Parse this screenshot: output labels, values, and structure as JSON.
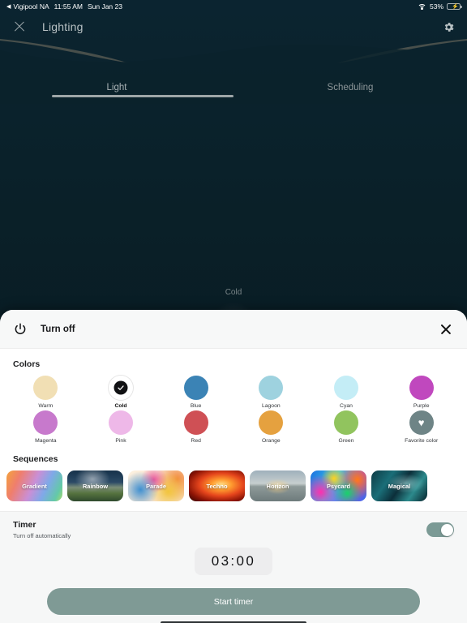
{
  "status_bar": {
    "back_glyph": "◀",
    "carrier": "Vigipool NA",
    "time": "11:55 AM",
    "date": "Sun Jan 23",
    "battery_percent": "53%",
    "wifi_icon": "wifi-icon",
    "battery_icon": "battery-charging-icon"
  },
  "header": {
    "close_icon": "close-icon",
    "title": "Lighting",
    "settings_icon": "gear-icon"
  },
  "tabs": [
    {
      "label": "Light",
      "active": true
    },
    {
      "label": "Scheduling",
      "active": false
    }
  ],
  "dial": {
    "label": "Cold"
  },
  "sheet": {
    "power_icon": "power-icon",
    "title": "Turn off",
    "close_icon": "close-icon"
  },
  "colors": {
    "section_title": "Colors",
    "items": [
      {
        "label": "Warm",
        "hex": "#F1DFB4",
        "selected": false,
        "icon": ""
      },
      {
        "label": "Cold",
        "hex": "#FFFFFF",
        "selected": true,
        "icon": "check-icon"
      },
      {
        "label": "Blue",
        "hex": "#3B83B5",
        "selected": false,
        "icon": ""
      },
      {
        "label": "Lagoon",
        "hex": "#9ED2DF",
        "selected": false,
        "icon": ""
      },
      {
        "label": "Cyan",
        "hex": "#C4EDF6",
        "selected": false,
        "icon": ""
      },
      {
        "label": "Purple",
        "hex": "#C048BE",
        "selected": false,
        "icon": ""
      },
      {
        "label": "Magenta",
        "hex": "#C779CC",
        "selected": false,
        "icon": ""
      },
      {
        "label": "Pink",
        "hex": "#EEB8E8",
        "selected": false,
        "icon": ""
      },
      {
        "label": "Red",
        "hex": "#CF5055",
        "selected": false,
        "icon": ""
      },
      {
        "label": "Orange",
        "hex": "#E5A13F",
        "selected": false,
        "icon": ""
      },
      {
        "label": "Green",
        "hex": "#91C45E",
        "selected": false,
        "icon": ""
      },
      {
        "label": "Favorite color",
        "hex": "#6E8486",
        "selected": false,
        "icon": "heart-icon"
      }
    ]
  },
  "sequences": {
    "section_title": "Sequences",
    "items": [
      {
        "label": "Gradient"
      },
      {
        "label": "Rainbow"
      },
      {
        "label": "Parade"
      },
      {
        "label": "Techno"
      },
      {
        "label": "Horizon"
      },
      {
        "label": "Psycard"
      },
      {
        "label": "Magical"
      }
    ]
  },
  "timer": {
    "title": "Timer",
    "subtitle": "Turn off automatically",
    "enabled": true,
    "value": "03:00",
    "start_label": "Start timer"
  },
  "theme": {
    "accent": "#7F9A95",
    "background_dark": "#0A2028",
    "sheet_background": "#FFFFFF"
  }
}
